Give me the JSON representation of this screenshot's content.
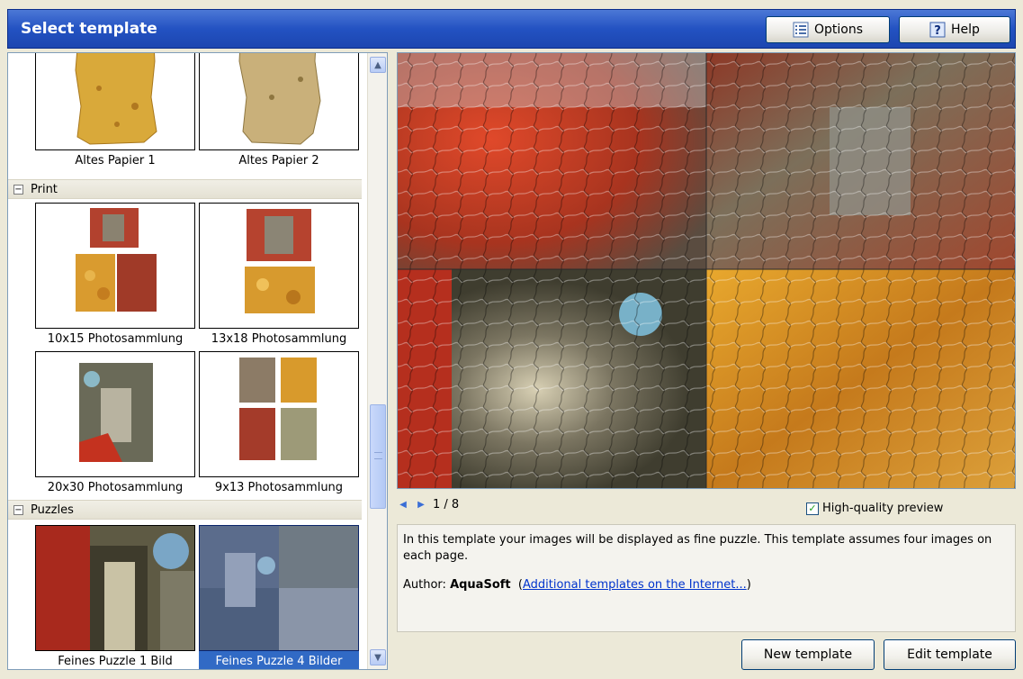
{
  "header": {
    "title": "Select template",
    "options_label": "Options",
    "help_label": "Help"
  },
  "templates": {
    "top_items": [
      {
        "label": "Altes Papier 1",
        "icon": "paper-thumbnail"
      },
      {
        "label": "Altes Papier 2",
        "icon": "paper-thumbnail"
      }
    ],
    "groups": [
      {
        "name": "Print",
        "toggle": "−",
        "items": [
          {
            "label": "10x15 Photosammlung"
          },
          {
            "label": "13x18 Photosammlung"
          },
          {
            "label": "20x30 Photosammlung"
          },
          {
            "label": "9x13 Photosammlung"
          }
        ]
      },
      {
        "name": "Puzzles",
        "toggle": "−",
        "items": [
          {
            "label": "Feines Puzzle 1 Bild"
          },
          {
            "label": "Feines Puzzle 4 Bilder",
            "selected": true
          }
        ]
      }
    ]
  },
  "preview": {
    "page_indicator": "1 / 8",
    "high_quality_label": "High-quality preview",
    "high_quality_checked": true
  },
  "description": {
    "text": "In this template your images will be displayed as fine puzzle. This template assumes four images on each page.",
    "author_label": "Author:",
    "author_name": "AquaSoft",
    "link_text": "Additional templates on the Internet..."
  },
  "footer": {
    "new_label": "New template",
    "edit_label": "Edit template"
  },
  "colors": {
    "title_bar": "#2352c2",
    "selection": "#316ac5",
    "link": "#0033cc"
  }
}
